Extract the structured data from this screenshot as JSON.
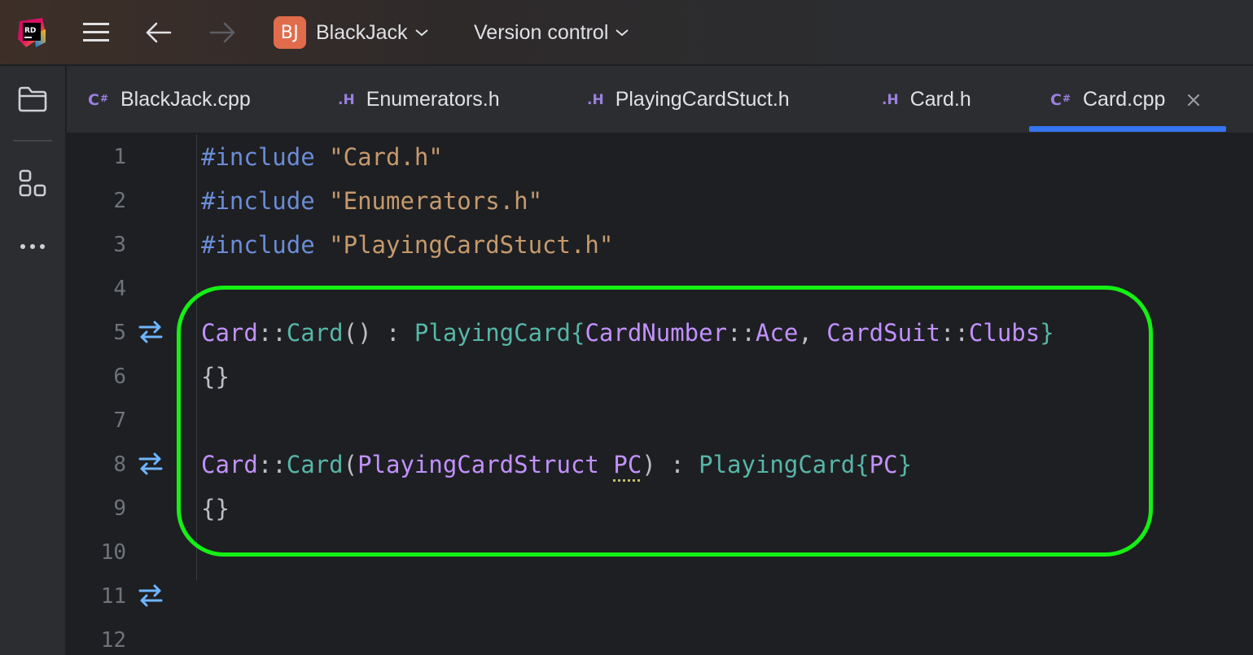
{
  "titlebar": {
    "project_badge": "BJ",
    "project_name": "BlackJack",
    "vcs_label": "Version control",
    "logo_text": "RD"
  },
  "sidebar": {
    "items": [
      {
        "icon": "folder-icon"
      },
      {
        "icon": "structure-icon"
      },
      {
        "icon": "more-icon"
      }
    ]
  },
  "tabs": [
    {
      "label": "BlackJack.cpp",
      "type": "cpp"
    },
    {
      "label": "Enumerators.h",
      "type": "h"
    },
    {
      "label": "PlayingCardStuct.h",
      "type": "h"
    },
    {
      "label": "Card.h",
      "type": "h"
    },
    {
      "label": "Card.cpp",
      "type": "cpp",
      "active": true
    }
  ],
  "tab_icon_h_text": ".H",
  "editor": {
    "line_numbers": [
      "1",
      "2",
      "3",
      "4",
      "5",
      "6",
      "7",
      "8",
      "9",
      "10",
      "11",
      "12"
    ],
    "lines": {
      "l1": {
        "kw": "#include",
        "str": "\"Card.h\""
      },
      "l2": {
        "kw": "#include",
        "str": "\"Enumerators.h\""
      },
      "l3": {
        "kw": "#include",
        "str": "\"PlayingCardStuct.h\""
      },
      "l5": {
        "cls1": "Card",
        "sep1": "::",
        "fn1": "Card",
        "p1": "() : ",
        "fn2": "PlayingCard",
        "b1": "{",
        "cls2": "CardNumber",
        "sep2": "::",
        "cls3": "Ace",
        "p2": ", ",
        "cls4": "CardSuit",
        "sep3": "::",
        "cls5": "Clubs",
        "b2": "}"
      },
      "l6": {
        "text": "{}"
      },
      "l8": {
        "cls1": "Card",
        "sep1": "::",
        "fn1": "Card",
        "p1": "(",
        "cls2": "PlayingCardStruct",
        "sp": " ",
        "param": "PC",
        "p2": ") : ",
        "fn2": "PlayingCard",
        "b1": "{",
        "cls3": "PC",
        "b2": "}"
      },
      "l9": {
        "text": "{}"
      }
    }
  },
  "colors": {
    "highlight": "#14f014",
    "accent": "#3574f0",
    "keyword": "#6b8dd6",
    "string": "#c59a6d",
    "class": "#c191ff",
    "function": "#56b6a8"
  }
}
